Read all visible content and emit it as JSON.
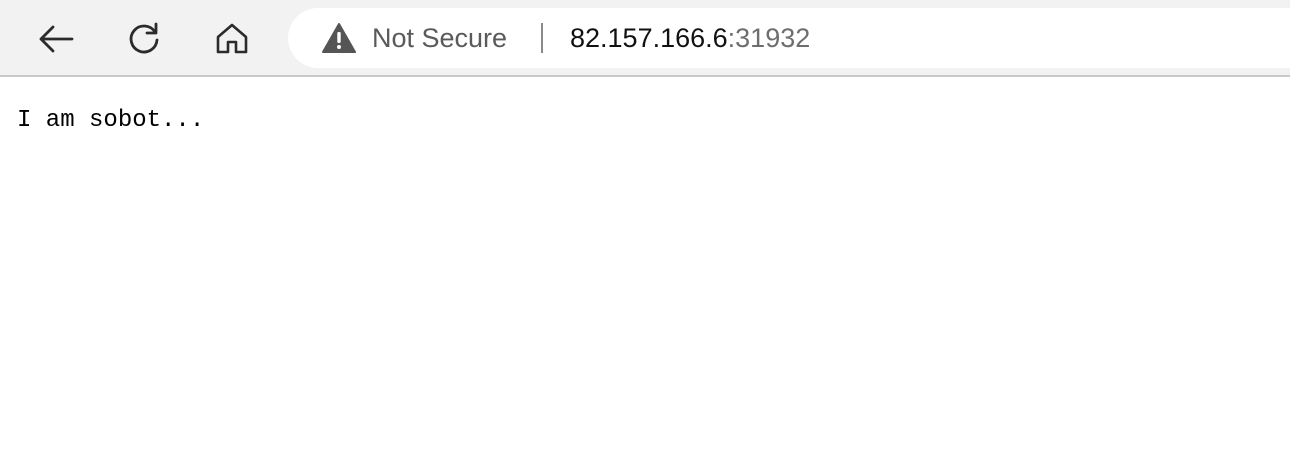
{
  "browser": {
    "toolbar": {
      "back_icon": "back-arrow-icon",
      "reload_icon": "reload-icon",
      "home_icon": "home-icon"
    },
    "address_bar": {
      "security_icon": "warning-triangle-icon",
      "security_label": "Not Secure",
      "url_host": "82.157.166.6",
      "url_port": ":31932"
    }
  },
  "page": {
    "body_text": "I am sobot..."
  }
}
